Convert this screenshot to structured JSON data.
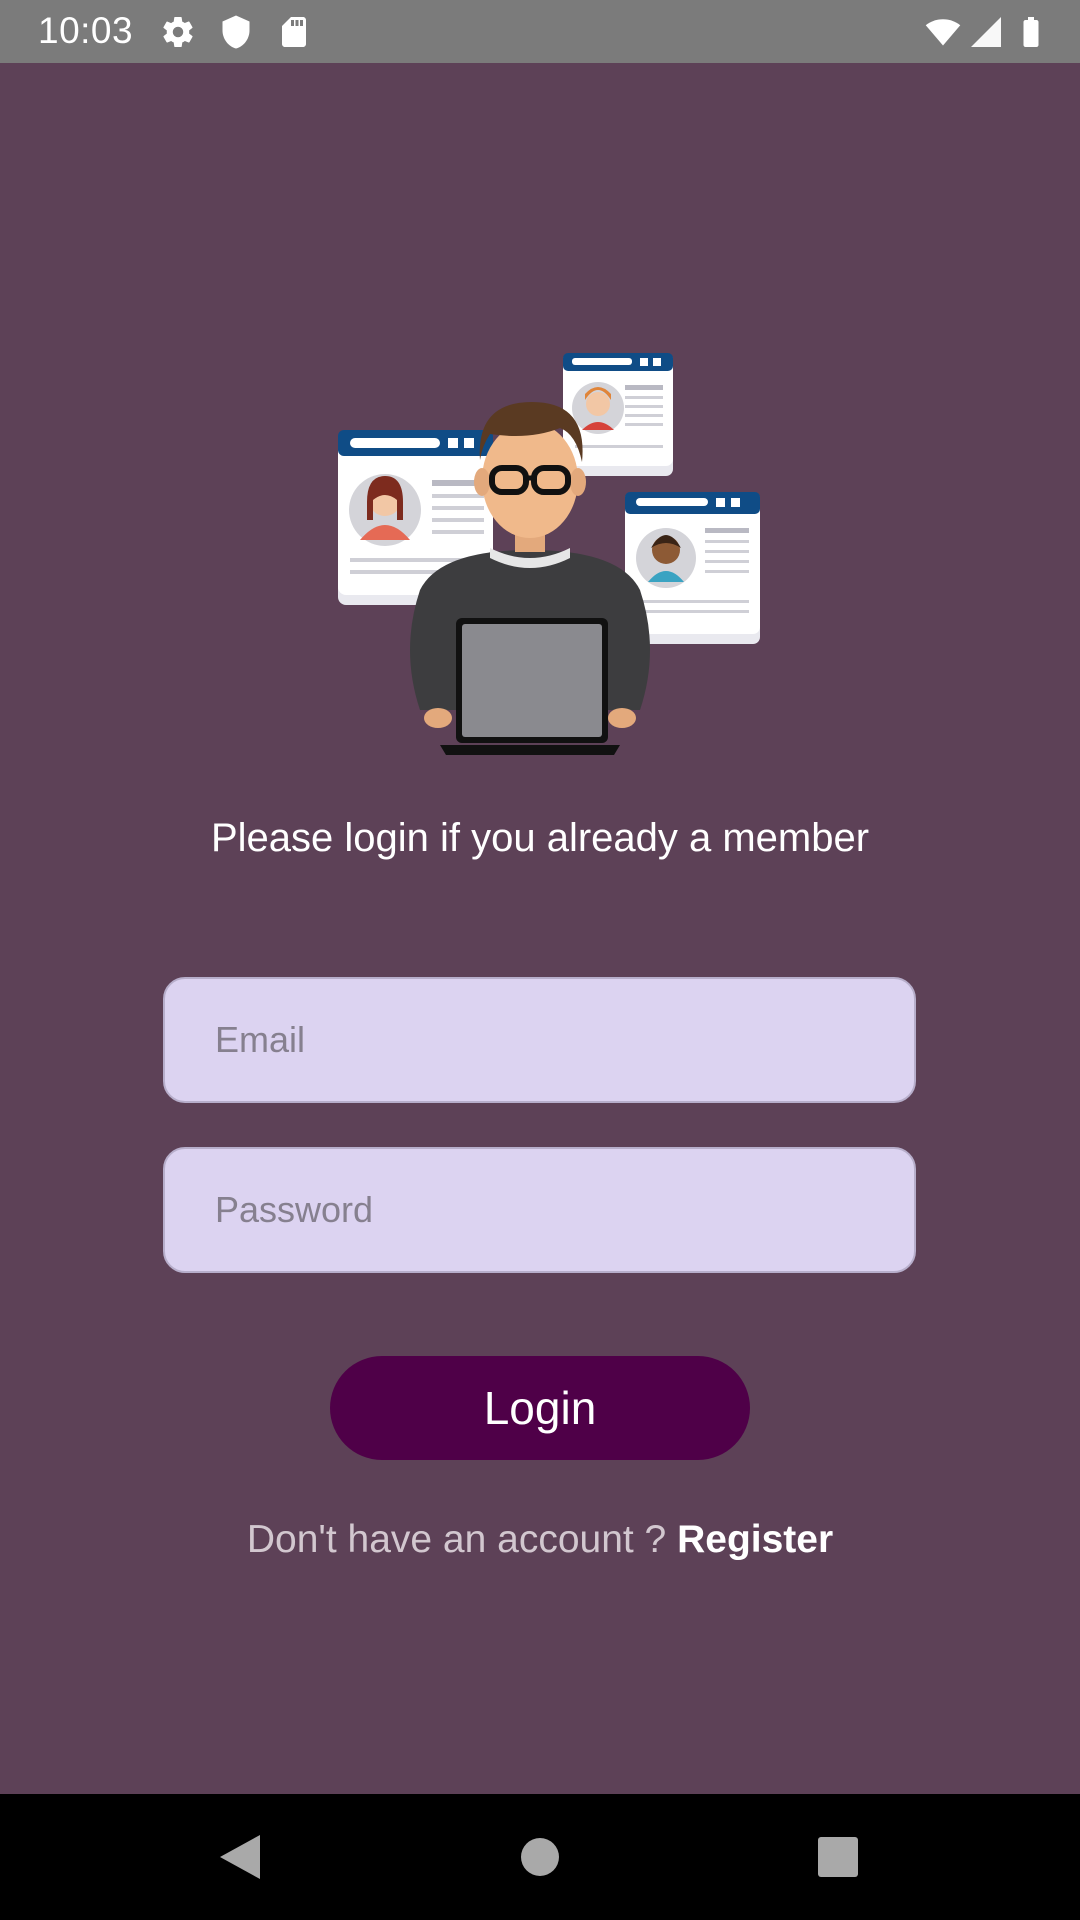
{
  "status_bar": {
    "time": "10:03",
    "icons_left": [
      "settings-icon",
      "shield-icon",
      "sd-card-icon"
    ],
    "icons_right": [
      "wifi-icon",
      "signal-icon",
      "battery-icon"
    ]
  },
  "illustration": {
    "icon": "user-with-laptop-and-profiles-illustration"
  },
  "login": {
    "headline": "Please login if you already a member",
    "email_placeholder": "Email",
    "password_placeholder": "Password",
    "button_label": "Login",
    "register_prompt": "Don't have an account ? ",
    "register_link": "Register"
  },
  "nav_bar": {
    "icons": [
      "back-icon",
      "home-icon",
      "recents-icon"
    ]
  },
  "colors": {
    "background": "#5d4157",
    "field_fill": "#dcd3f1",
    "button": "#4f0048",
    "status_bar": "#7b7b7b"
  }
}
